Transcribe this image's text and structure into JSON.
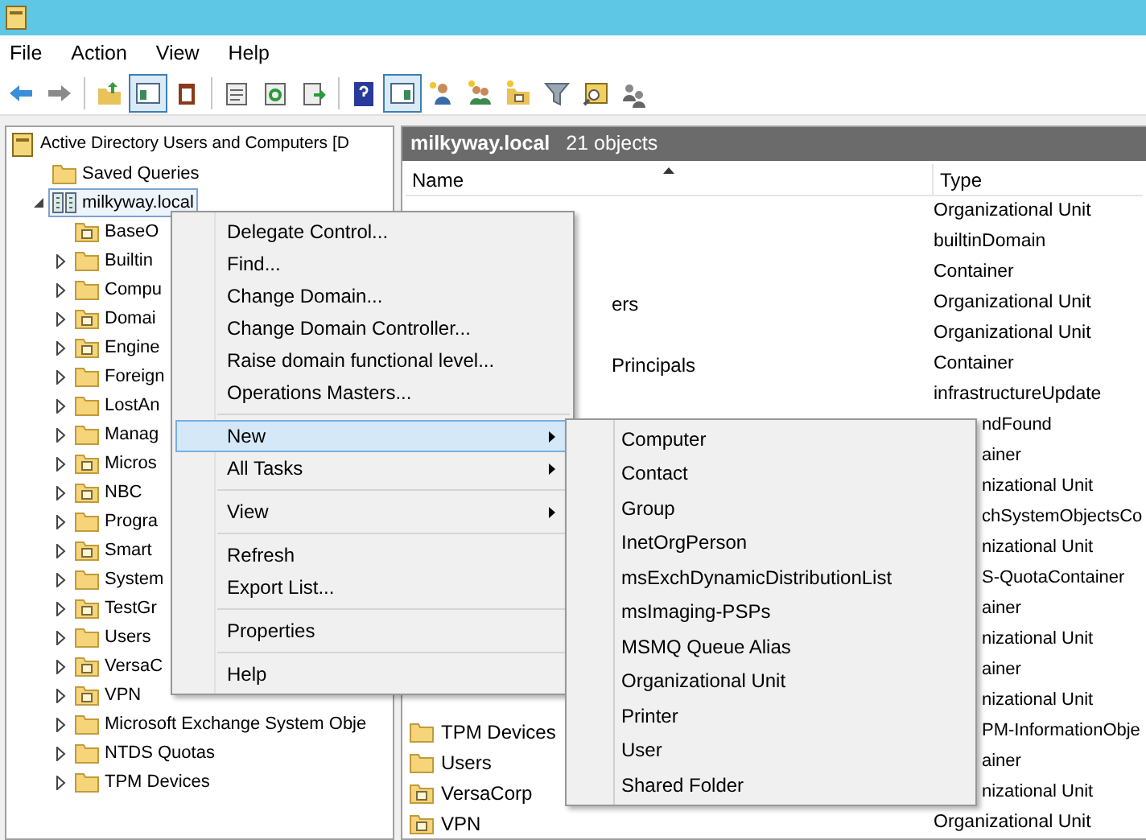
{
  "menu_bar": [
    "File",
    "Action",
    "View",
    "Help"
  ],
  "toolbar": [
    [
      {
        "kind": "back",
        "pressed": false
      },
      {
        "kind": "forward",
        "pressed": false
      }
    ],
    [
      {
        "kind": "folder-up",
        "pressed": false
      },
      {
        "kind": "tree-pane",
        "pressed": true
      },
      {
        "kind": "clipboard",
        "pressed": false
      }
    ],
    [
      {
        "kind": "properties",
        "pressed": false
      },
      {
        "kind": "refresh",
        "pressed": false
      },
      {
        "kind": "export",
        "pressed": false
      }
    ],
    [
      {
        "kind": "help",
        "pressed": false
      },
      {
        "kind": "action-pane",
        "pressed": true
      },
      {
        "kind": "new-user",
        "pressed": false
      },
      {
        "kind": "new-group",
        "pressed": false
      },
      {
        "kind": "new-ou",
        "pressed": false
      },
      {
        "kind": "filter",
        "pressed": false
      },
      {
        "kind": "find",
        "pressed": false
      },
      {
        "kind": "delegate",
        "pressed": false
      }
    ]
  ],
  "tree": [
    {
      "label": "Active Directory Users and Computers [D",
      "kind": "console",
      "expandable": false,
      "selected": false,
      "children": [
        {
          "label": "Saved Queries",
          "kind": "folder",
          "expandable": false,
          "selected": false
        },
        {
          "label": "milkyway.local",
          "kind": "domain",
          "expandable": true,
          "expanded": true,
          "selected": true,
          "children": [
            {
              "label": "BaseO",
              "kind": "ou",
              "expandable": false,
              "selected": false
            },
            {
              "label": "Builtin",
              "kind": "folder",
              "expandable": true,
              "expanded": false,
              "selected": false
            },
            {
              "label": "Compu",
              "kind": "folder",
              "expandable": true,
              "expanded": false,
              "selected": false
            },
            {
              "label": "Domai",
              "kind": "ou",
              "expandable": true,
              "expanded": false,
              "selected": false
            },
            {
              "label": "Engine",
              "kind": "ou",
              "expandable": true,
              "expanded": false,
              "selected": false
            },
            {
              "label": "Foreign",
              "kind": "folder",
              "expandable": true,
              "expanded": false,
              "selected": false
            },
            {
              "label": "LostAn",
              "kind": "folder",
              "expandable": true,
              "expanded": false,
              "selected": false
            },
            {
              "label": "Manag",
              "kind": "folder",
              "expandable": true,
              "expanded": false,
              "selected": false
            },
            {
              "label": "Micros",
              "kind": "ou",
              "expandable": true,
              "expanded": false,
              "selected": false
            },
            {
              "label": "NBC",
              "kind": "ou",
              "expandable": true,
              "expanded": false,
              "selected": false
            },
            {
              "label": "Progra",
              "kind": "folder",
              "expandable": true,
              "expanded": false,
              "selected": false
            },
            {
              "label": "Smart",
              "kind": "ou",
              "expandable": true,
              "expanded": false,
              "selected": false
            },
            {
              "label": "System",
              "kind": "folder",
              "expandable": true,
              "expanded": false,
              "selected": false
            },
            {
              "label": "TestGr",
              "kind": "ou",
              "expandable": true,
              "expanded": false,
              "selected": false
            },
            {
              "label": "Users",
              "kind": "folder",
              "expandable": true,
              "expanded": false,
              "selected": false
            },
            {
              "label": "VersaC",
              "kind": "ou",
              "expandable": true,
              "expanded": false,
              "selected": false
            },
            {
              "label": "VPN",
              "kind": "ou",
              "expandable": true,
              "expanded": false,
              "selected": false
            },
            {
              "label": "Microsoft Exchange System Obje",
              "kind": "folder",
              "expandable": true,
              "expanded": false,
              "selected": false
            },
            {
              "label": "NTDS Quotas",
              "kind": "folder",
              "expandable": true,
              "expanded": false,
              "selected": false
            },
            {
              "label": "TPM Devices",
              "kind": "folder",
              "expandable": true,
              "expanded": false,
              "selected": false
            }
          ]
        }
      ]
    }
  ],
  "details": {
    "title": "milkyway.local",
    "count": "21 objects",
    "columns": [
      "Name",
      "Type"
    ],
    "rows": [
      {
        "type": "Organizational Unit",
        "type_clipped": false
      },
      {
        "type": "builtinDomain",
        "type_clipped": false
      },
      {
        "type": "Container",
        "type_clipped": false
      },
      {
        "name": "ers",
        "name_clipped": true,
        "type": "Organizational Unit",
        "type_clipped": false
      },
      {
        "type": "Organizational Unit",
        "type_clipped": false
      },
      {
        "name": "Principals",
        "name_clipped": true,
        "type": "Container",
        "type_clipped": false
      },
      {
        "type": "infrastructureUpdate",
        "type_clipped": false
      },
      {
        "type": "ndFound",
        "type_clipped": true
      },
      {
        "type": "ainer",
        "type_clipped": true
      },
      {
        "type": "nizational Unit",
        "type_clipped": true
      },
      {
        "type": "chSystemObjectsCo",
        "type_clipped": true
      },
      {
        "type": "nizational Unit",
        "type_clipped": true
      },
      {
        "type": "S-QuotaContainer",
        "type_clipped": true
      },
      {
        "type": "ainer",
        "type_clipped": true
      },
      {
        "type": "nizational Unit",
        "type_clipped": true
      },
      {
        "type": "ainer",
        "type_clipped": true
      },
      {
        "type": "nizational Unit",
        "type_clipped": true
      },
      {
        "name": "TPM Devices",
        "kind": "folder",
        "name_clipped": false,
        "type": "PM-InformationObje",
        "type_clipped": true
      },
      {
        "name": "Users",
        "kind": "folder",
        "name_clipped": false,
        "type": "ainer",
        "type_clipped": true
      },
      {
        "name": "VersaCorp",
        "kind": "ou",
        "name_clipped": false,
        "type": "nizational Unit",
        "type_clipped": true
      },
      {
        "name": "VPN",
        "kind": "ou",
        "name_clipped": false,
        "type": "Organizational Unit",
        "type_clipped": false
      }
    ]
  },
  "context_menu": [
    [
      {
        "label": "Delegate Control...",
        "submenu": false,
        "selected": false
      },
      {
        "label": "Find...",
        "submenu": false,
        "selected": false
      },
      {
        "label": "Change Domain...",
        "submenu": false,
        "selected": false
      },
      {
        "label": "Change Domain Controller...",
        "submenu": false,
        "selected": false
      },
      {
        "label": "Raise domain functional level...",
        "submenu": false,
        "selected": false
      },
      {
        "label": "Operations Masters...",
        "submenu": false,
        "selected": false
      }
    ],
    [
      {
        "label": "New",
        "submenu": true,
        "selected": true
      },
      {
        "label": "All Tasks",
        "submenu": true,
        "selected": false
      }
    ],
    [
      {
        "label": "View",
        "submenu": true,
        "selected": false
      }
    ],
    [
      {
        "label": "Refresh",
        "submenu": false,
        "selected": false
      },
      {
        "label": "Export List...",
        "submenu": false,
        "selected": false
      }
    ],
    [
      {
        "label": "Properties",
        "submenu": false,
        "selected": false
      }
    ],
    [
      {
        "label": "Help",
        "submenu": false,
        "selected": false
      }
    ]
  ],
  "submenu": [
    "Computer",
    "Contact",
    "Group",
    "InetOrgPerson",
    "msExchDynamicDistributionList",
    "msImaging-PSPs",
    "MSMQ Queue Alias",
    "Organizational Unit",
    "Printer",
    "User",
    "Shared Folder"
  ]
}
